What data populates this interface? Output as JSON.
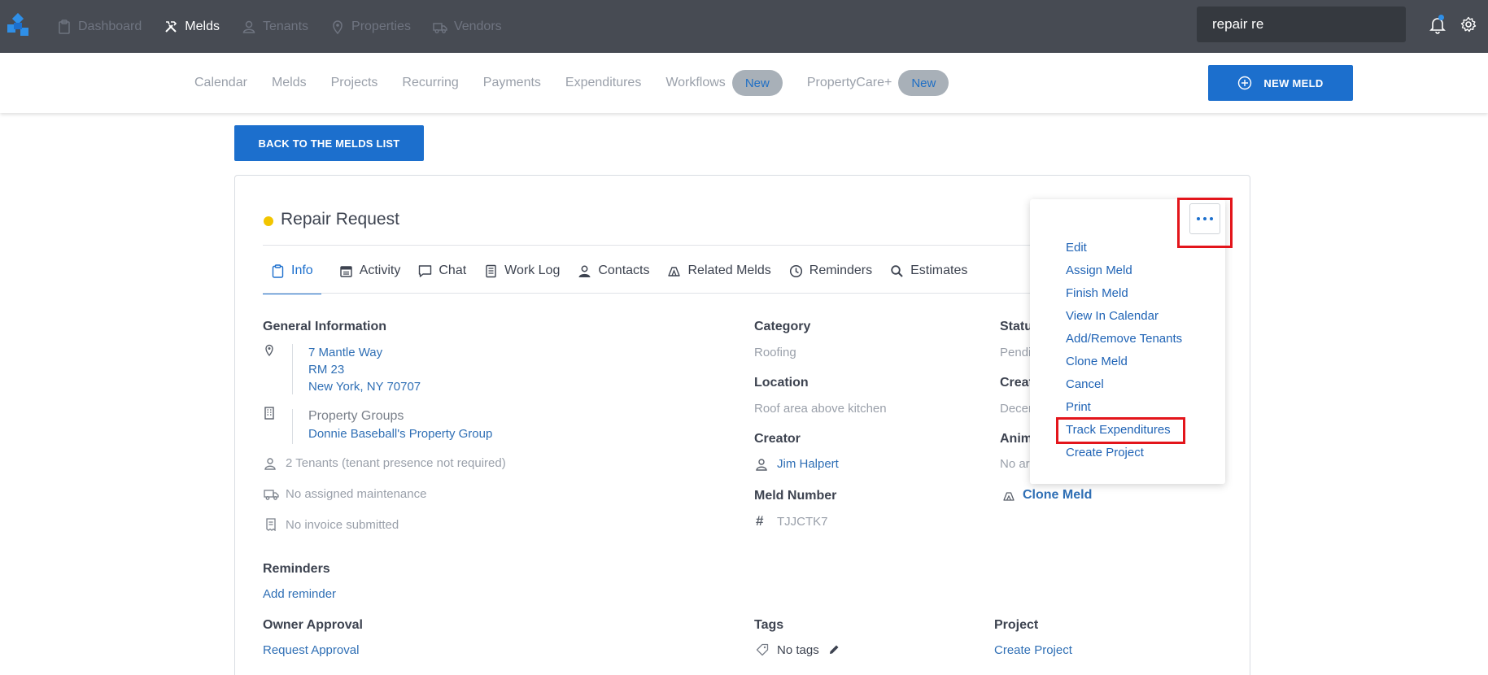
{
  "topnav": {
    "items": [
      {
        "label": "Dashboard",
        "icon": "clipboard-icon"
      },
      {
        "label": "Melds",
        "icon": "tools-icon"
      },
      {
        "label": "Tenants",
        "icon": "person-icon"
      },
      {
        "label": "Properties",
        "icon": "map-pin-icon"
      },
      {
        "label": "Vendors",
        "icon": "truck-icon"
      }
    ],
    "active": "Melds",
    "search_value": "repair re"
  },
  "subnav": {
    "items": [
      "Calendar",
      "Melds",
      "Projects",
      "Recurring",
      "Payments",
      "Expenditures",
      "Workflows",
      "PropertyCare+"
    ],
    "new_pill": "New",
    "new_meld_label": "NEW MELD"
  },
  "back_label": "BACK TO THE MELDS LIST",
  "meld": {
    "title": "Repair Request",
    "status_color": "#f2c500",
    "tabs": [
      "Info",
      "Activity",
      "Chat",
      "Work Log",
      "Contacts",
      "Related Melds",
      "Reminders",
      "Estimates"
    ],
    "general_information": {
      "heading": "General Information",
      "address_line1": "7 Mantle Way",
      "address_line2": "RM 23",
      "address_line3": "New York, NY 70707",
      "property_groups_label": "Property Groups",
      "property_group": "Donnie Baseball's Property Group",
      "tenants": "2 Tenants (tenant presence not required)",
      "maintenance": "No assigned maintenance",
      "invoice": "No invoice submitted"
    },
    "category": {
      "label": "Category",
      "value": "Roofing"
    },
    "location": {
      "label": "Location",
      "value": "Roof area above kitchen"
    },
    "creator": {
      "label": "Creator",
      "value": "Jim Halpert"
    },
    "meld_number": {
      "label": "Meld Number",
      "value": "TJJCTK7"
    },
    "status": {
      "label": "Statu",
      "value": "Pendi"
    },
    "created": {
      "label": "Creat",
      "value": "Decer"
    },
    "animals": {
      "label": "Anim",
      "value": "No ar"
    },
    "clone_meld_link": "Clone Meld",
    "reminders": {
      "label": "Reminders",
      "link": "Add reminder"
    },
    "owner_approval": {
      "label": "Owner Approval",
      "link": "Request Approval"
    },
    "tags": {
      "label": "Tags",
      "value": "No tags"
    },
    "project": {
      "label": "Project",
      "link": "Create Project"
    }
  },
  "actions_menu": {
    "items": [
      "Edit",
      "Assign Meld",
      "Finish Meld",
      "View In Calendar",
      "Add/Remove Tenants",
      "Clone Meld",
      "Cancel",
      "Print",
      "Track Expenditures",
      "Create Project"
    ],
    "highlighted": "Track Expenditures"
  },
  "colors": {
    "topbar": "#474b53",
    "primary": "#1c6fcd",
    "highlight": "#e3151b"
  }
}
